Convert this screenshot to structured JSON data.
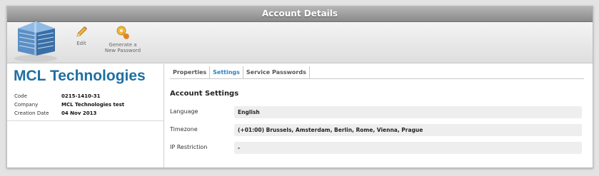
{
  "window": {
    "title": "Account Details"
  },
  "toolbar": {
    "edit_label": "Edit",
    "generate_label": "Generate a\nNew Password"
  },
  "account": {
    "company_name": "MCL Technologies",
    "fields": {
      "code_label": "Code",
      "code_value": "0215-1410-31",
      "company_label": "Company",
      "company_value": "MCL Technologies test",
      "creation_label": "Creation Date",
      "creation_value": "04 Nov 2013"
    }
  },
  "tabs": {
    "properties": "Properties",
    "settings": "Settings",
    "service_passwords": "Service Passwords",
    "active": "Settings"
  },
  "settings": {
    "section_title": "Account Settings",
    "language_label": "Language",
    "language_value": "English",
    "timezone_label": "Timezone",
    "timezone_value": "(+01:00) Brussels, Amsterdam, Berlin, Rome, Vienna, Prague",
    "ip_label": "IP Restriction",
    "ip_value": "-"
  },
  "icons": {
    "logo": "building-icon",
    "edit": "pencil-icon",
    "generate": "key-icon"
  },
  "colors": {
    "accent": "#1f6fa3",
    "active_tab": "#2a84c2"
  }
}
